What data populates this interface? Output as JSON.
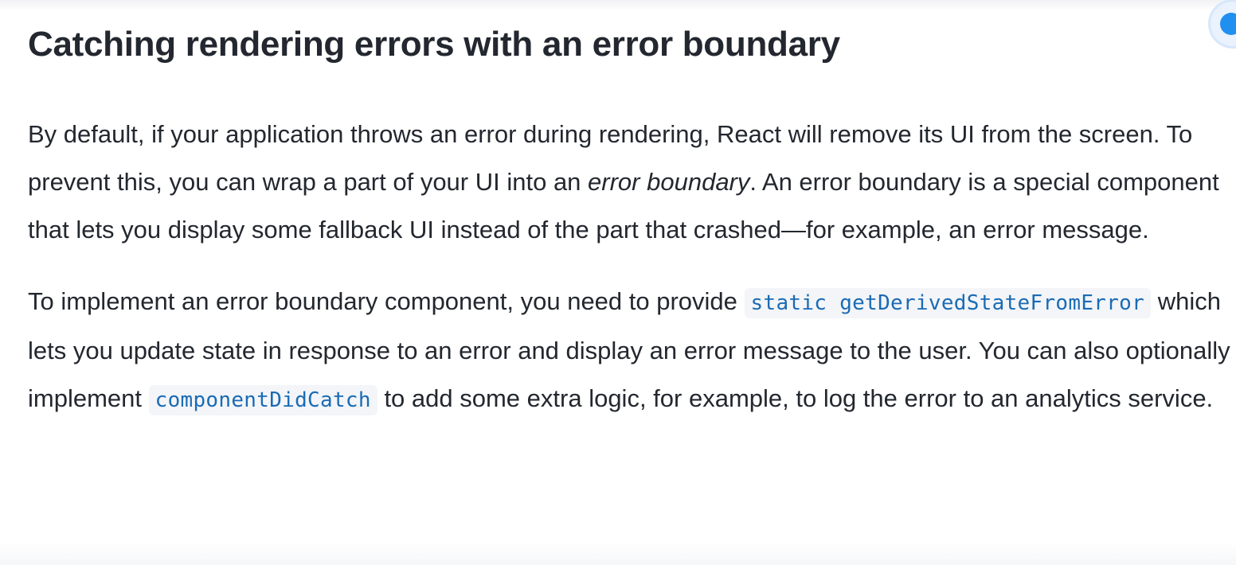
{
  "heading": "Catching rendering errors with an error boundary",
  "paragraph1": {
    "part1": "By default, if your application throws an error during rendering, React will remove its UI from the screen. To prevent this, you can wrap a part of your UI into an ",
    "emphasis": "error boundary",
    "part2": ". An error boundary is a special component that lets you display some fallback UI instead of the part that crashed—for example, an error message."
  },
  "paragraph2": {
    "part1": "To implement an error boundary component, you need to provide ",
    "code1": "static getDerivedStateFromError",
    "part2": " which lets you update state in response to an error and display an error message to the user. You can also optionally implement ",
    "code2": "componentDidCatch",
    "part3": " to add some extra logic, for example, to log the error to an analytics service."
  },
  "colors": {
    "text": "#23272f",
    "code_text": "#1a6bb5",
    "code_background": "#f3f5f8",
    "accent": "#1f8ff0"
  },
  "icons": {
    "corner_button": "chat-bubble-icon"
  }
}
